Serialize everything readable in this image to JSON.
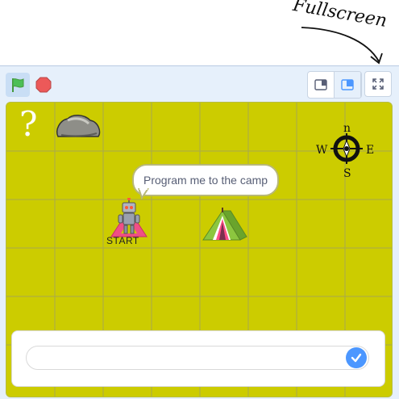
{
  "annotation": {
    "text": "Fullscreen"
  },
  "toolbar": {
    "green_flag": "green-flag-icon",
    "stop": "stop-icon",
    "small_stage": "small-stage-icon",
    "normal_stage": "normal-stage-icon",
    "fullscreen": "fullscreen-icon"
  },
  "stage": {
    "question_mark": "?",
    "speech": "Program me to the camp",
    "start_label": "START",
    "compass": {
      "n": "n",
      "w": "W",
      "e": "E",
      "s": "S"
    }
  },
  "answer": {
    "value": "",
    "placeholder": ""
  },
  "colors": {
    "stage_bg": "#cccc00",
    "toolbar_bg": "#e6f0fb",
    "accent": "#4c97ff",
    "flag": "#4cbf56",
    "stop": "#ec5959"
  }
}
